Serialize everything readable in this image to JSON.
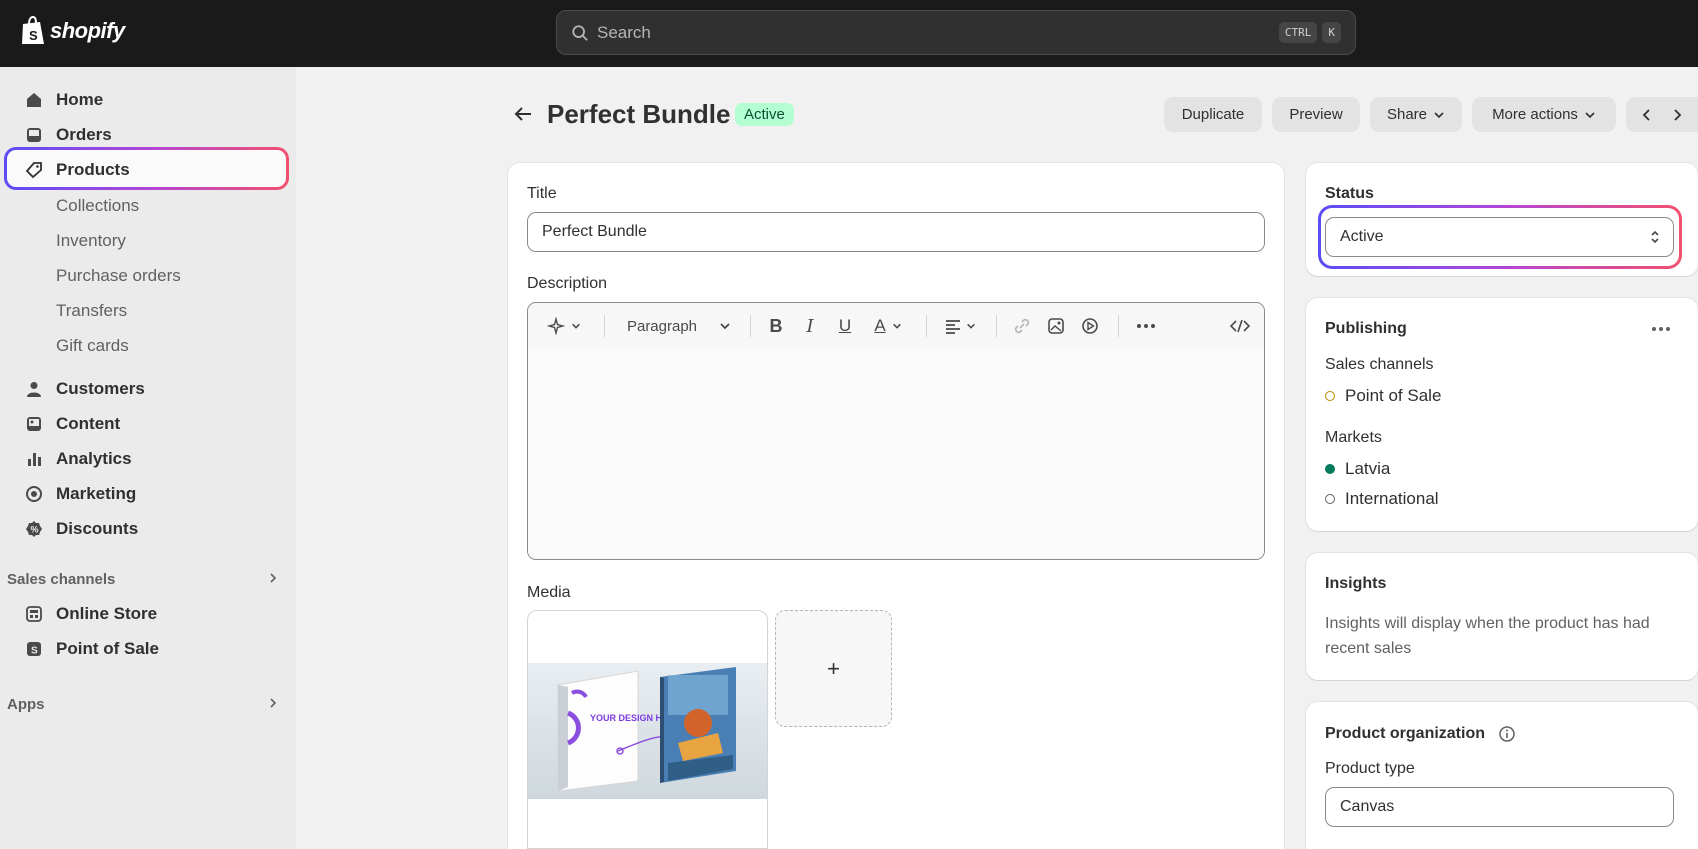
{
  "topbar": {
    "brand": "shopify",
    "search_placeholder": "Search",
    "shortcut_keys": [
      "CTRL",
      "K"
    ]
  },
  "sidebar": {
    "items": [
      {
        "label": "Home",
        "icon": "home-icon"
      },
      {
        "label": "Orders",
        "icon": "orders-icon"
      },
      {
        "label": "Products",
        "icon": "tag-icon",
        "active": true
      }
    ],
    "product_subitems": [
      "Collections",
      "Inventory",
      "Purchase orders",
      "Transfers",
      "Gift cards"
    ],
    "items2": [
      {
        "label": "Customers",
        "icon": "person-icon"
      },
      {
        "label": "Content",
        "icon": "content-icon"
      },
      {
        "label": "Analytics",
        "icon": "analytics-icon"
      },
      {
        "label": "Marketing",
        "icon": "target-icon"
      },
      {
        "label": "Discounts",
        "icon": "discount-icon"
      }
    ],
    "sales_channels_heading": "Sales channels",
    "channels": [
      {
        "label": "Online Store",
        "icon": "store-icon"
      },
      {
        "label": "Point of Sale",
        "icon": "pos-icon"
      }
    ],
    "apps_heading": "Apps"
  },
  "page": {
    "title": "Perfect Bundle",
    "status_badge": "Active",
    "actions": {
      "duplicate": "Duplicate",
      "preview": "Preview",
      "share": "Share",
      "more": "More actions"
    }
  },
  "main_card": {
    "title_label": "Title",
    "title_value": "Perfect Bundle",
    "description_label": "Description",
    "format_select": "Paragraph",
    "media_label": "Media",
    "media_add": "+",
    "media_thumbnail_text": "YOUR DESIGN HERE"
  },
  "status_card": {
    "heading": "Status",
    "value": "Active"
  },
  "publishing_card": {
    "heading": "Publishing",
    "sales_channels_label": "Sales channels",
    "channels": [
      {
        "label": "Point of Sale",
        "color": "#b98900",
        "filled": false
      }
    ],
    "markets_label": "Markets",
    "markets": [
      {
        "label": "Latvia",
        "color": "#047b5d",
        "filled": true
      },
      {
        "label": "International",
        "color": "#616161",
        "filled": false
      }
    ]
  },
  "insights_card": {
    "heading": "Insights",
    "text": "Insights will display when the product has had recent sales"
  },
  "organization_card": {
    "heading": "Product organization",
    "product_type_label": "Product type",
    "product_type_value": "Canvas"
  },
  "colors": {
    "topbar": "#1a1a1a",
    "badge_bg": "#b4fed2",
    "highlight_start": "#5b4cf5",
    "highlight_end": "#f2506e"
  }
}
